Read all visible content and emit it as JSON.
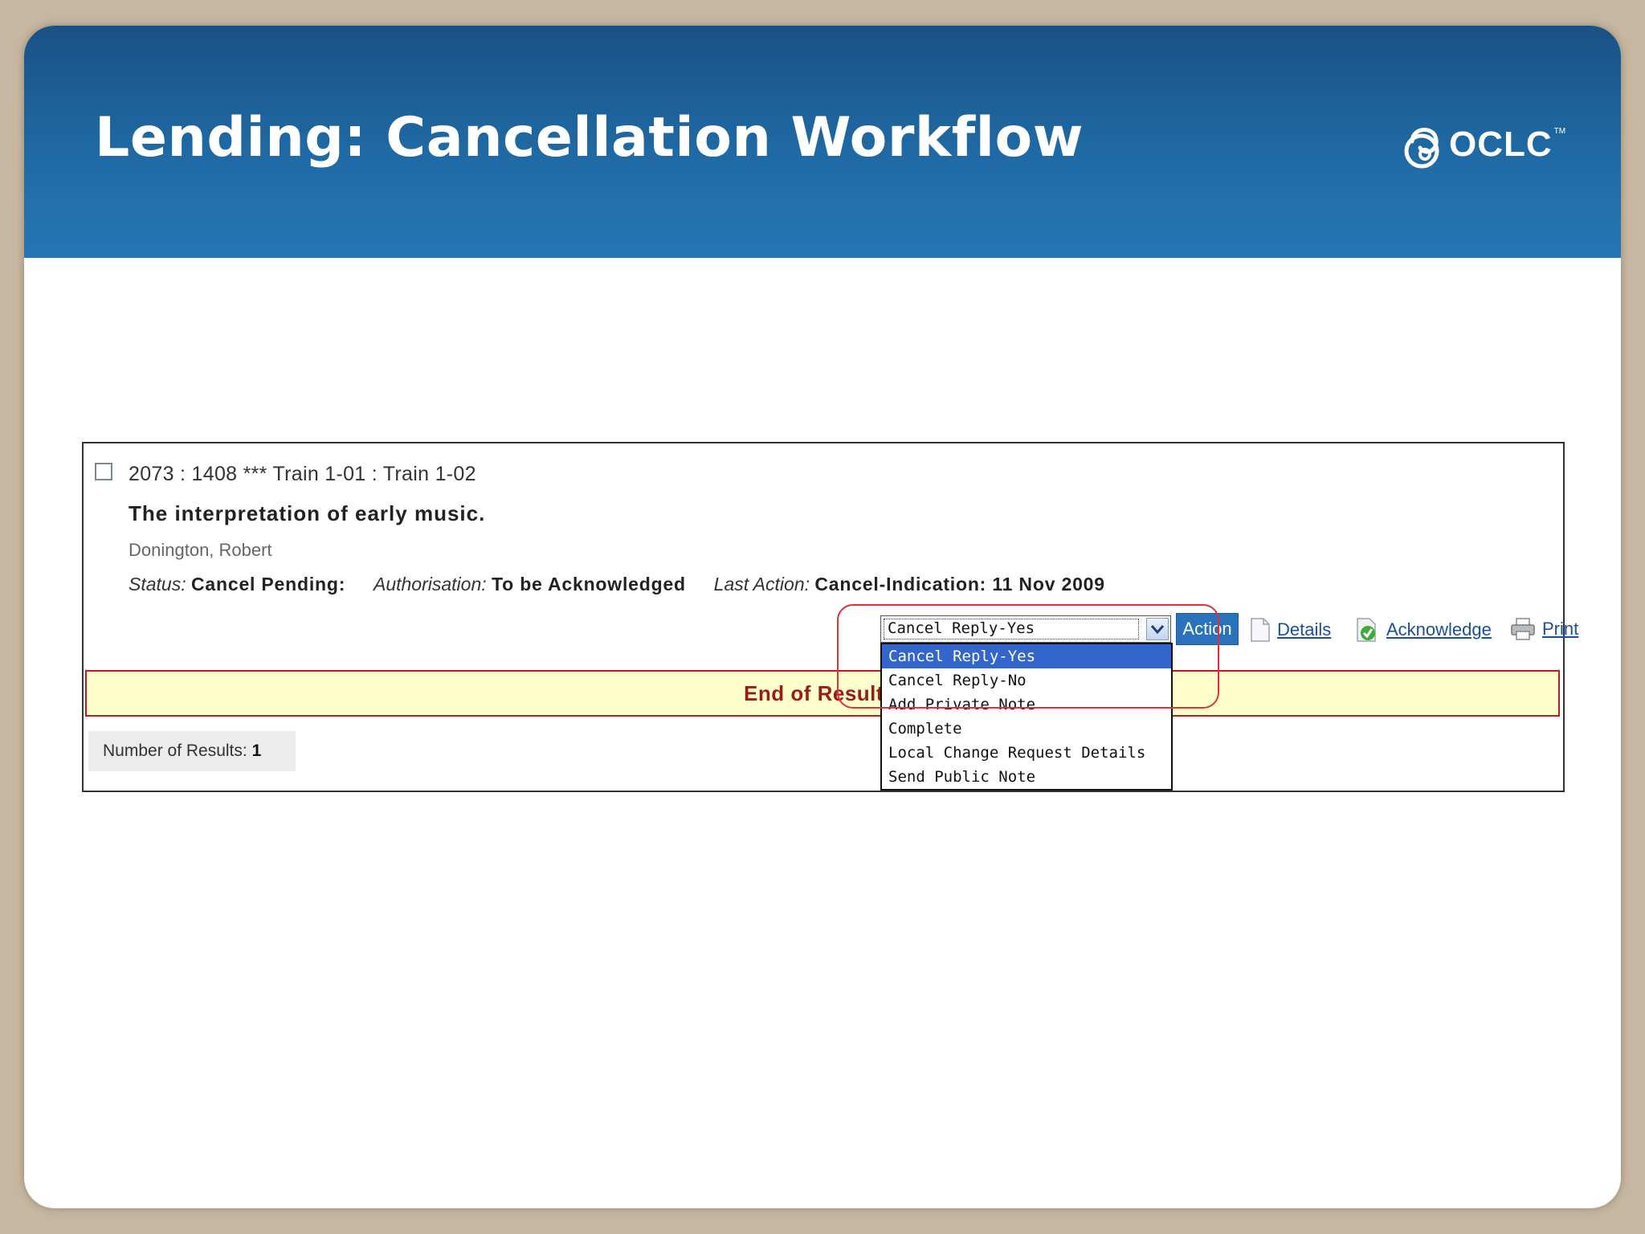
{
  "slide": {
    "title": "Lending: Cancellation Workflow",
    "logo_text": "OCLC",
    "logo_tm": "TM"
  },
  "request": {
    "id_line": "2073 : 1408 *** Train 1-01 : Train 1-02",
    "title": "The interpretation of early music.",
    "author": "Donington, Robert",
    "status_label": "Status:",
    "status_value": "Cancel Pending:",
    "authorisation_label": "Authorisation:",
    "authorisation_value": "To be Acknowledged",
    "last_action_label": "Last Action:",
    "last_action_value": "Cancel-Indication: 11 Nov 2009"
  },
  "action_select": {
    "selected": "Cancel Reply-Yes",
    "options": [
      "Cancel Reply-Yes",
      "Cancel Reply-No",
      "Add Private Note",
      "Complete",
      "Local Change Request Details",
      "Send Public Note"
    ],
    "button_label": "Action"
  },
  "links": {
    "details": "Details",
    "acknowledge": "Acknowledge",
    "print": "Print"
  },
  "results": {
    "end_text": "End of Results",
    "count_label": "Number of Results:",
    "count_value": "1"
  },
  "icons": {
    "details": "document-icon",
    "acknowledge": "checkmark-icon",
    "print": "printer-icon",
    "dropdown": "chevron-down-icon",
    "logo": "oclc-logo-icon"
  },
  "colors": {
    "banner": "#1f6aa5",
    "selected_option": "#3366cc",
    "end_bar_bg": "#ffffcc",
    "end_bar_text": "#9b1b1b",
    "highlight": "#e0303a",
    "link": "#1a4f9a"
  }
}
